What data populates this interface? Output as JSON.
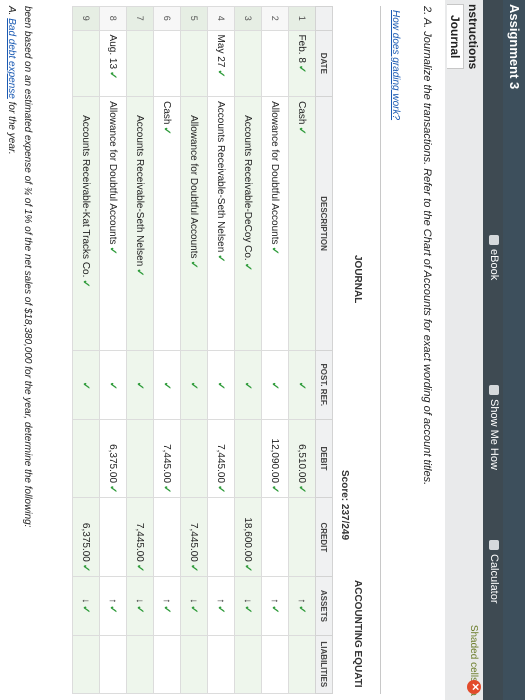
{
  "window": {
    "title": "Assignment 3"
  },
  "toolbar": {
    "ebook_label": "eBook",
    "showmehow_label": "Show Me How",
    "calculator_label": "Calculator",
    "shaded_note": "Shaded cells ha"
  },
  "tabs": {
    "instructions": "nstructions",
    "journal": "Journal"
  },
  "question": {
    "text": "2. A. Journalize the transactions. Refer to the Chart of Accounts for exact wording of account titles.",
    "how_link": "How does grading work?"
  },
  "journal": {
    "title": "JOURNAL",
    "score": "Score: 237/249",
    "accounting_eq": "ACCOUNTING EQUATI",
    "headers": {
      "date": "DATE",
      "description": "DESCRIPTION",
      "post_ref": "POST. REF.",
      "debit": "DEBIT",
      "credit": "CREDIT",
      "assets": "ASSETS",
      "liabilities": "LIABILITIES"
    },
    "rows": [
      {
        "num": "1",
        "date": "Feb. 8",
        "desc": "Cash",
        "debit": "6,510.00",
        "credit": "",
        "assets": "↑",
        "liab": ""
      },
      {
        "num": "2",
        "date": "",
        "desc": "Allowance for Doubtful Accounts",
        "debit": "12,090.00",
        "credit": "",
        "assets": "↑",
        "liab": ""
      },
      {
        "num": "3",
        "date": "",
        "desc": "Accounts Receivable-DeCoy Co.",
        "debit": "",
        "credit": "18,600.00",
        "assets": "↓",
        "liab": ""
      },
      {
        "num": "4",
        "date": "May 27",
        "desc": "Accounts Receivable-Seth Nelsen",
        "debit": "7,445.00",
        "credit": "",
        "assets": "↑",
        "liab": ""
      },
      {
        "num": "5",
        "date": "",
        "desc": "Allowance for Doubtful Accounts",
        "debit": "",
        "credit": "7,445.00",
        "assets": "↓",
        "liab": ""
      },
      {
        "num": "6",
        "date": "",
        "desc": "Cash",
        "debit": "7,445.00",
        "credit": "",
        "assets": "↑",
        "liab": ""
      },
      {
        "num": "7",
        "date": "",
        "desc": "Accounts Receivable-Seth Nelsen",
        "debit": "",
        "credit": "7,445.00",
        "assets": "↓",
        "liab": ""
      },
      {
        "num": "8",
        "date": "Aug. 13",
        "desc": "Allowance for Doubtful Accounts",
        "debit": "6,375.00",
        "credit": "",
        "assets": "↑",
        "liab": ""
      },
      {
        "num": "9",
        "date": "",
        "desc": "Accounts Receivable-Kat Tracks Co.",
        "debit": "",
        "credit": "6,375.00",
        "assets": "↓",
        "liab": ""
      }
    ]
  },
  "footer": {
    "note": "been based on an estimated expense of ¾ of 1% of the net sales of $18,380,000 for the year, determine the following:",
    "item_a_prefix": "A.",
    "item_a_link": "Bad debt expense",
    "item_a_suffix": "for the year."
  }
}
